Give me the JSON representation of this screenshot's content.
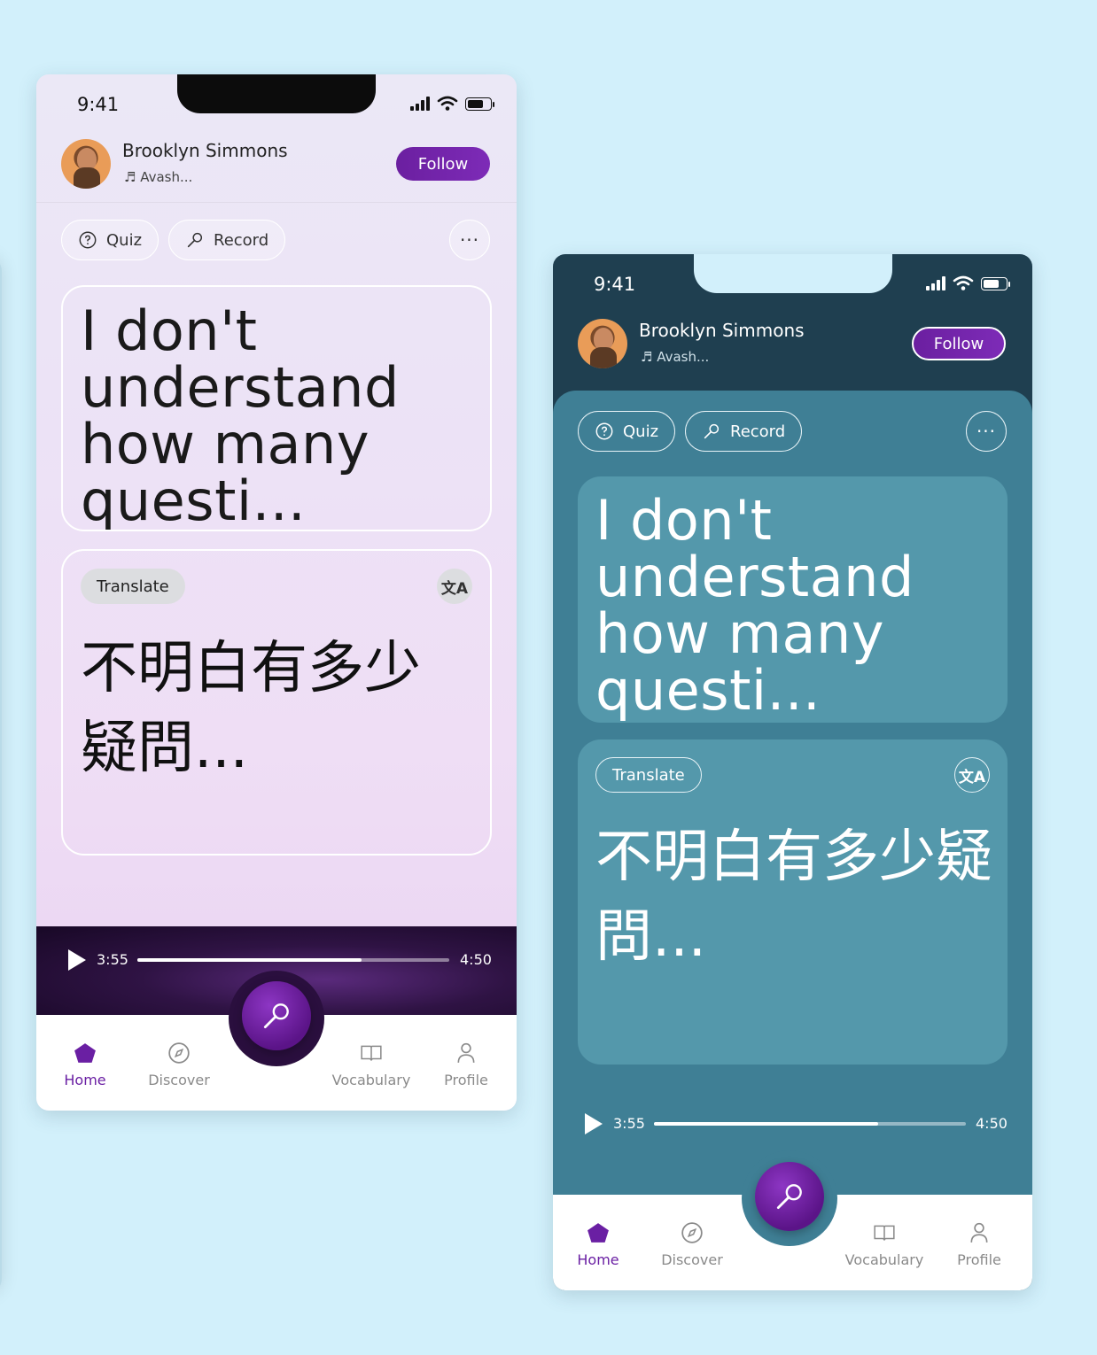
{
  "status": {
    "time": "9:41"
  },
  "user": {
    "name": "Brooklyn Simmons",
    "track": "♬ Avash..."
  },
  "follow_label": "Follow",
  "chips": {
    "quiz": "Quiz",
    "record": "Record",
    "more": "···"
  },
  "phrase": "I don't understand how many questi...",
  "translation": {
    "label": "Translate",
    "icon_text": "文A",
    "text": "不明白有多少疑問..."
  },
  "player": {
    "current": "3:55",
    "total": "4:50",
    "progress": 0.72
  },
  "tabs": [
    {
      "label": "Home",
      "icon": "home-icon"
    },
    {
      "label": "Discover",
      "icon": "compass-icon"
    },
    {
      "label": "Vocabulary",
      "icon": "book-icon"
    },
    {
      "label": "Profile",
      "icon": "person-icon"
    }
  ],
  "colors": {
    "accent": "#6a1fa3",
    "dark_bg": "#1f3f50",
    "card_teal": "#5498ab",
    "page_bg": "#d2f0fb"
  }
}
